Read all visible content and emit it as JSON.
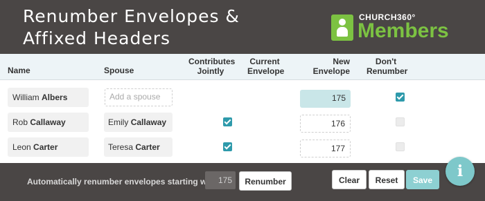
{
  "header": {
    "title_line1": "Renumber Envelopes &",
    "title_line2": "Affixed Headers",
    "logo_small": "CHURCH360°",
    "logo_big": "Members"
  },
  "table": {
    "columns": {
      "name": "Name",
      "spouse": "Spouse",
      "jointly_1": "Contributes",
      "jointly_2": "Jointly",
      "current_1": "Current",
      "current_2": "Envelope",
      "new_1": "New",
      "new_2": "Envelope",
      "dont_1": "Don't",
      "dont_2": "Renumber"
    },
    "rows": [
      {
        "first": "William",
        "last": "Albers",
        "spouse_first": "",
        "spouse_last": "",
        "spouse_placeholder": "Add a spouse",
        "jointly": false,
        "current": "",
        "new": "175",
        "dont_renumber": true
      },
      {
        "first": "Rob",
        "last": "Callaway",
        "spouse_first": "Emily",
        "spouse_last": "Callaway",
        "jointly": true,
        "current": "",
        "new": "176",
        "dont_renumber": false
      },
      {
        "first": "Leon",
        "last": "Carter",
        "spouse_first": "Teresa",
        "spouse_last": "Carter",
        "jointly": true,
        "current": "",
        "new": "177",
        "dont_renumber": false
      }
    ]
  },
  "footer": {
    "auto_label": "Automatically renumber envelopes starting with",
    "start_value": "175",
    "renumber_label": "Renumber",
    "clear_label": "Clear",
    "reset_label": "Reset",
    "save_label": "Save"
  },
  "info_icon": "i",
  "colors": {
    "header_bg": "#4a4645",
    "brand_green": "#7cc242",
    "accent_teal": "#2e9aab",
    "save_bg": "#8dd0d2"
  }
}
